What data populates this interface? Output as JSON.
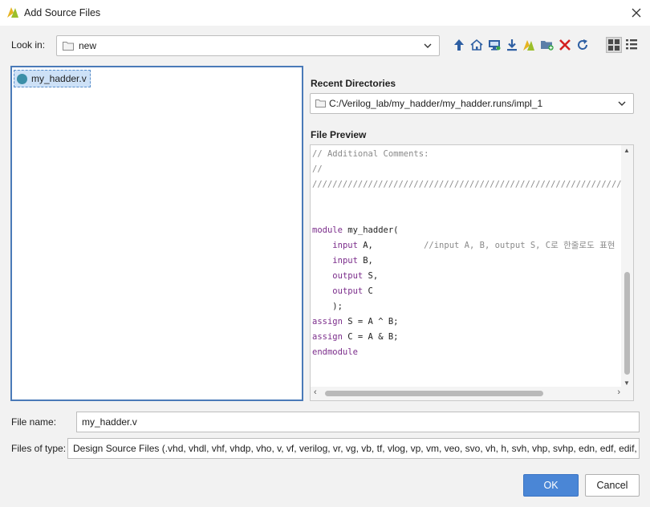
{
  "window": {
    "title": "Add Source Files"
  },
  "look_in": {
    "label": "Look in:",
    "value": "new"
  },
  "toolbar": {
    "icons": [
      "up-one-level-icon",
      "home-icon",
      "desktop-icon",
      "download-icon",
      "vivado-project-icon",
      "new-folder-icon",
      "delete-icon",
      "refresh-icon",
      "details-view-icon",
      "list-view-icon"
    ]
  },
  "file_list": {
    "items": [
      {
        "name": "my_hadder.v",
        "selected": true
      }
    ]
  },
  "recent_directories": {
    "label": "Recent Directories",
    "value": "C:/Verilog_lab/my_hadder/my_hadder.runs/impl_1"
  },
  "file_preview": {
    "label": "File Preview",
    "lines": [
      {
        "text": "// Additional Comments:",
        "style": "comment"
      },
      {
        "text": "//",
        "style": "comment"
      },
      {
        "text": "////////////////////////////////////////////////////////////////////",
        "style": "comment"
      },
      {
        "text": "",
        "style": "plain"
      },
      {
        "text": "",
        "style": "plain"
      },
      {
        "text": "module my_hadder(",
        "style": "kw-start",
        "kw": "module",
        "rest": " my_hadder("
      },
      {
        "text": "    input A,          //input A, B, output S, C로 한줄로도 표현",
        "style": "input-comment",
        "kw": "input",
        "pre": "    ",
        "rest": " A,          ",
        "comment": "//input A, B, output S, C로 한줄로도 표현"
      },
      {
        "text": "    input B,",
        "style": "kw-indent",
        "kw": "input",
        "pre": "    ",
        "rest": " B,"
      },
      {
        "text": "    output S,",
        "style": "kw-indent",
        "kw": "output",
        "pre": "    ",
        "rest": " S,"
      },
      {
        "text": "    output C",
        "style": "kw-indent",
        "kw": "output",
        "pre": "    ",
        "rest": " C"
      },
      {
        "text": "    );",
        "style": "plain"
      },
      {
        "text": "assign S = A ^ B;",
        "style": "kw-start",
        "kw": "assign",
        "rest": " S = A ^ B;"
      },
      {
        "text": "assign C = A & B;",
        "style": "kw-start",
        "kw": "assign",
        "rest": " C = A & B;"
      },
      {
        "text": "endmodule",
        "style": "kw-start",
        "kw": "endmodule",
        "rest": ""
      }
    ]
  },
  "file_name": {
    "label": "File name:",
    "value": "my_hadder.v"
  },
  "files_of_type": {
    "label": "Files of type:",
    "value": "Design Source Files (.vhd, vhdl, vhf, vhdp, vho, v, vf, verilog, vr, vg, vb, tf, vlog, vp, vm, veo, svo, vh, h, svh, vhp, svhp, edn, edf, edif, ngc)"
  },
  "buttons": {
    "ok": "OK",
    "cancel": "Cancel"
  },
  "colors": {
    "accent": "#4a86d6",
    "selection": "#cde1f7",
    "keyword": "#7b2d8b",
    "comment": "#8a8a8a"
  }
}
